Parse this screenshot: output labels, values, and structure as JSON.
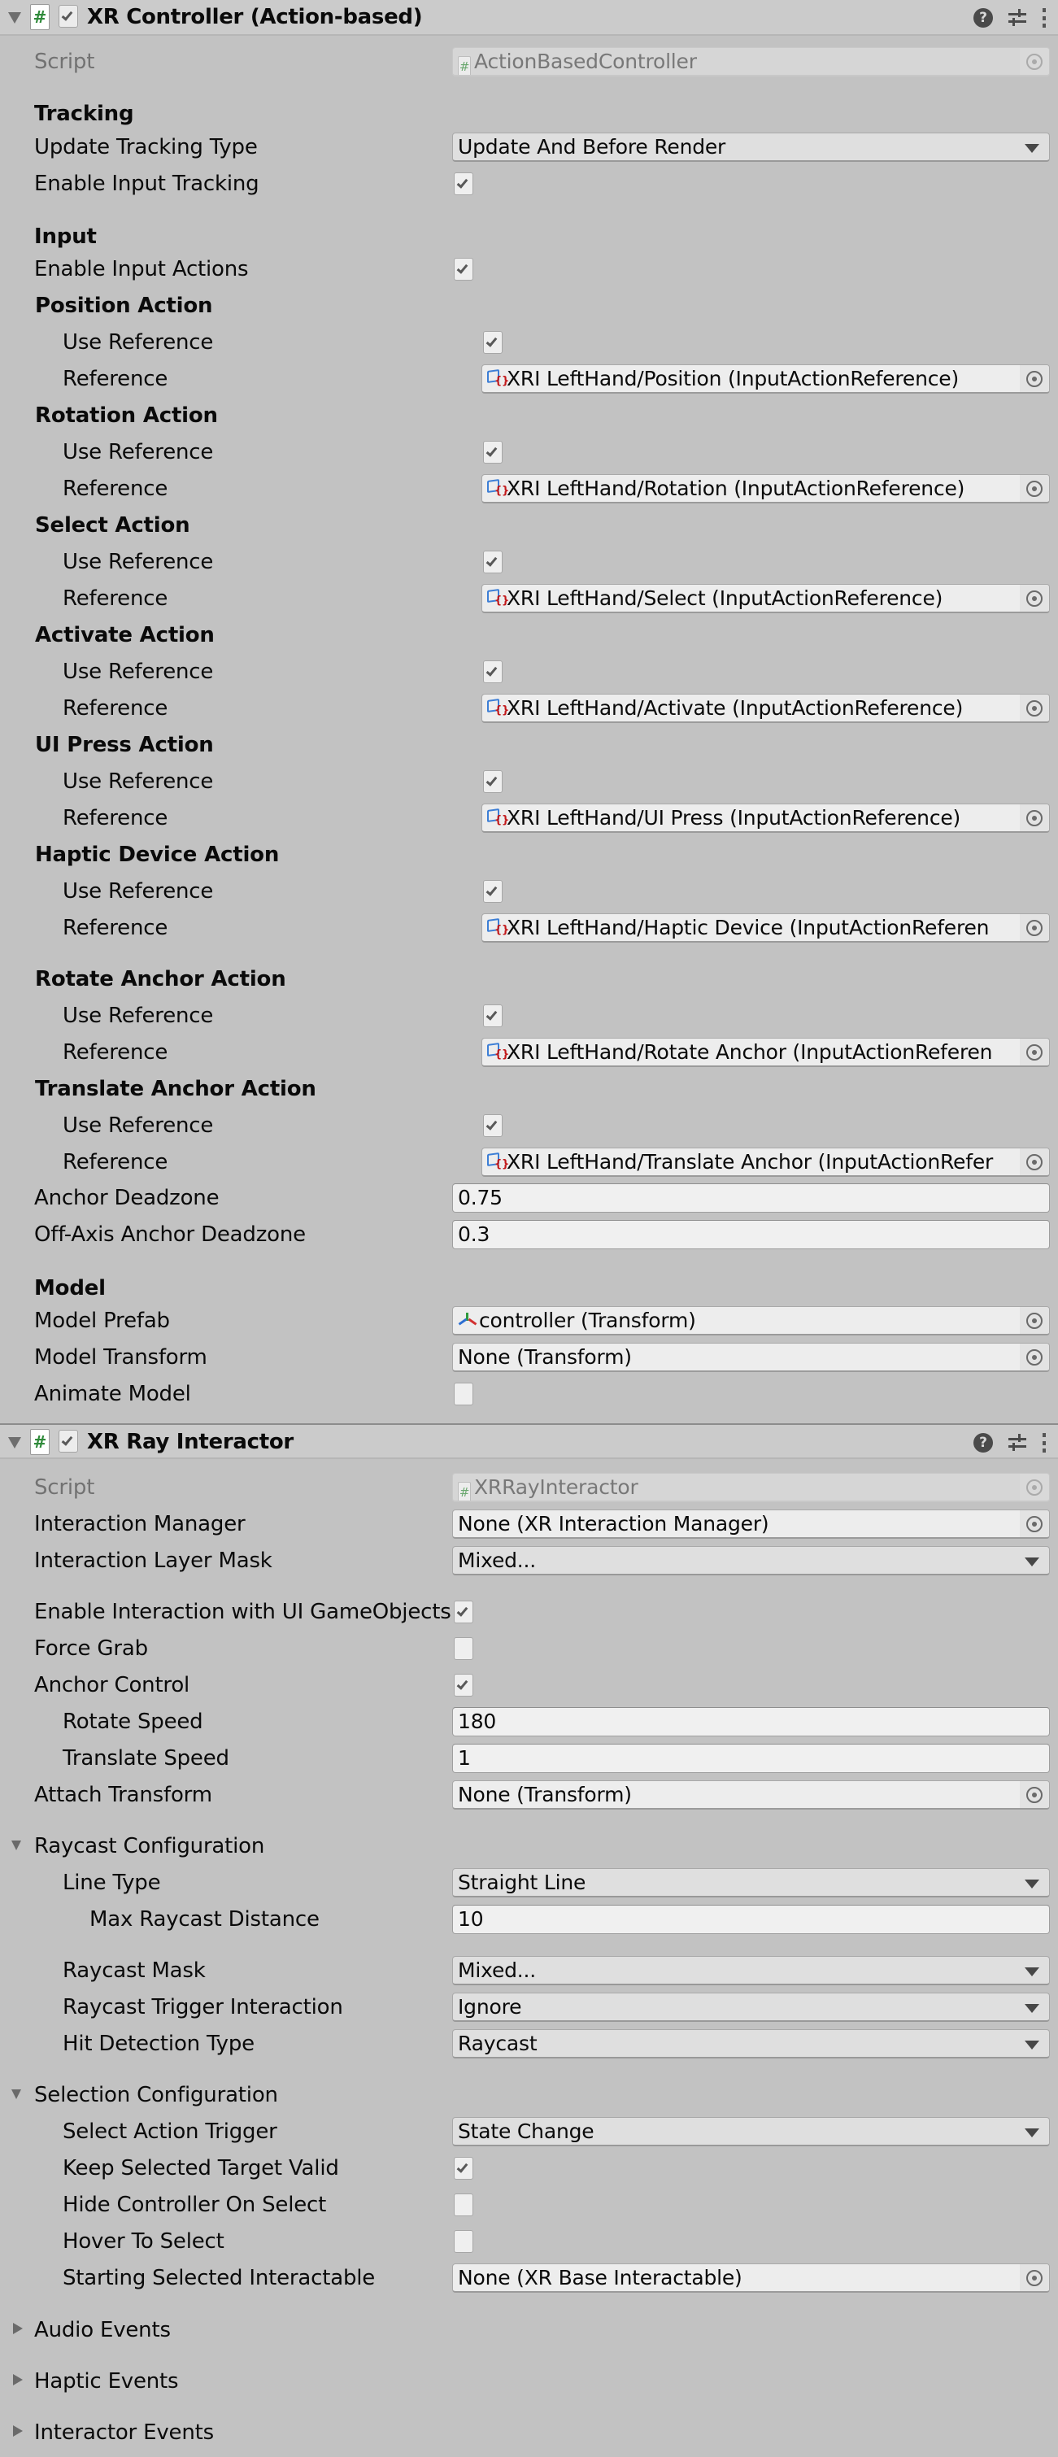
{
  "controller": {
    "title": "XR Controller (Action-based)",
    "enabled": true,
    "script_label": "Script",
    "script_value": "ActionBasedController",
    "tracking_header": "Tracking",
    "update_tracking_type": {
      "label": "Update Tracking Type",
      "value": "Update And Before Render"
    },
    "enable_input_tracking": {
      "label": "Enable Input Tracking",
      "checked": true
    },
    "input_header": "Input",
    "enable_input_actions": {
      "label": "Enable Input Actions",
      "checked": true
    },
    "actions": [
      {
        "header": "Position Action",
        "use_reference_label": "Use Reference",
        "use_reference": true,
        "reference_label": "Reference",
        "reference": "XRI LeftHand/Position (InputActionReference)"
      },
      {
        "header": "Rotation Action",
        "use_reference_label": "Use Reference",
        "use_reference": true,
        "reference_label": "Reference",
        "reference": "XRI LeftHand/Rotation (InputActionReference)"
      },
      {
        "header": "Select Action",
        "use_reference_label": "Use Reference",
        "use_reference": true,
        "reference_label": "Reference",
        "reference": "XRI LeftHand/Select (InputActionReference)"
      },
      {
        "header": "Activate Action",
        "use_reference_label": "Use Reference",
        "use_reference": true,
        "reference_label": "Reference",
        "reference": "XRI LeftHand/Activate (InputActionReference)"
      },
      {
        "header": "UI Press Action",
        "use_reference_label": "Use Reference",
        "use_reference": true,
        "reference_label": "Reference",
        "reference": "XRI LeftHand/UI Press (InputActionReference)"
      },
      {
        "header": "Haptic Device Action",
        "use_reference_label": "Use Reference",
        "use_reference": true,
        "reference_label": "Reference",
        "reference": "XRI LeftHand/Haptic Device (InputActionReferen"
      },
      {
        "header": "Rotate Anchor Action",
        "use_reference_label": "Use Reference",
        "use_reference": true,
        "reference_label": "Reference",
        "reference": "XRI LeftHand/Rotate Anchor (InputActionReferen"
      },
      {
        "header": "Translate Anchor Action",
        "use_reference_label": "Use Reference",
        "use_reference": true,
        "reference_label": "Reference",
        "reference": "XRI LeftHand/Translate Anchor (InputActionRefer"
      }
    ],
    "anchor_deadzone": {
      "label": "Anchor Deadzone",
      "value": "0.75"
    },
    "off_axis_anchor_deadzone": {
      "label": "Off-Axis Anchor Deadzone",
      "value": "0.3"
    },
    "model_header": "Model",
    "model_prefab": {
      "label": "Model Prefab",
      "value": "controller (Transform)"
    },
    "model_transform": {
      "label": "Model Transform",
      "value": "None (Transform)"
    },
    "animate_model": {
      "label": "Animate Model",
      "checked": false
    }
  },
  "ray_interactor": {
    "title": "XR Ray Interactor",
    "enabled": true,
    "script_label": "Script",
    "script_value": "XRRayInteractor",
    "interaction_manager": {
      "label": "Interaction Manager",
      "value": "None (XR Interaction Manager)"
    },
    "interaction_layer_mask": {
      "label": "Interaction Layer Mask",
      "value": "Mixed..."
    },
    "enable_ui_interaction": {
      "label": "Enable Interaction with UI GameObjects",
      "checked": true
    },
    "force_grab": {
      "label": "Force Grab",
      "checked": false
    },
    "anchor_control": {
      "label": "Anchor Control",
      "checked": true
    },
    "rotate_speed": {
      "label": "Rotate Speed",
      "value": "180"
    },
    "translate_speed": {
      "label": "Translate Speed",
      "value": "1"
    },
    "attach_transform": {
      "label": "Attach Transform",
      "value": "None (Transform)"
    },
    "raycast_configuration": {
      "label": "Raycast Configuration",
      "expanded": true,
      "line_type": {
        "label": "Line Type",
        "value": "Straight Line"
      },
      "max_raycast_distance": {
        "label": "Max Raycast Distance",
        "value": "10"
      },
      "raycast_mask": {
        "label": "Raycast Mask",
        "value": "Mixed..."
      },
      "raycast_trigger_interaction": {
        "label": "Raycast Trigger Interaction",
        "value": "Ignore"
      },
      "hit_detection_type": {
        "label": "Hit Detection Type",
        "value": "Raycast"
      }
    },
    "selection_configuration": {
      "label": "Selection Configuration",
      "expanded": true,
      "select_action_trigger": {
        "label": "Select Action Trigger",
        "value": "State Change"
      },
      "keep_selected_target_valid": {
        "label": "Keep Selected Target Valid",
        "checked": true
      },
      "hide_controller_on_select": {
        "label": "Hide Controller On Select",
        "checked": false
      },
      "hover_to_select": {
        "label": "Hover To Select",
        "checked": false
      },
      "starting_selected_interactable": {
        "label": "Starting Selected Interactable",
        "value": "None (XR Base Interactable)"
      }
    },
    "audio_events": {
      "label": "Audio Events",
      "expanded": false
    },
    "haptic_events": {
      "label": "Haptic Events",
      "expanded": false
    },
    "interactor_events": {
      "label": "Interactor Events",
      "expanded": false
    }
  },
  "icons": {
    "component": "script-icon",
    "help": "help-icon",
    "presets": "presets-icon",
    "menu": "kebab-menu-icon",
    "object_picker": "object-picker-icon",
    "input_action_reference": "input-action-reference-icon",
    "transform": "transform-icon",
    "dropdown": "dropdown-arrow-icon"
  }
}
